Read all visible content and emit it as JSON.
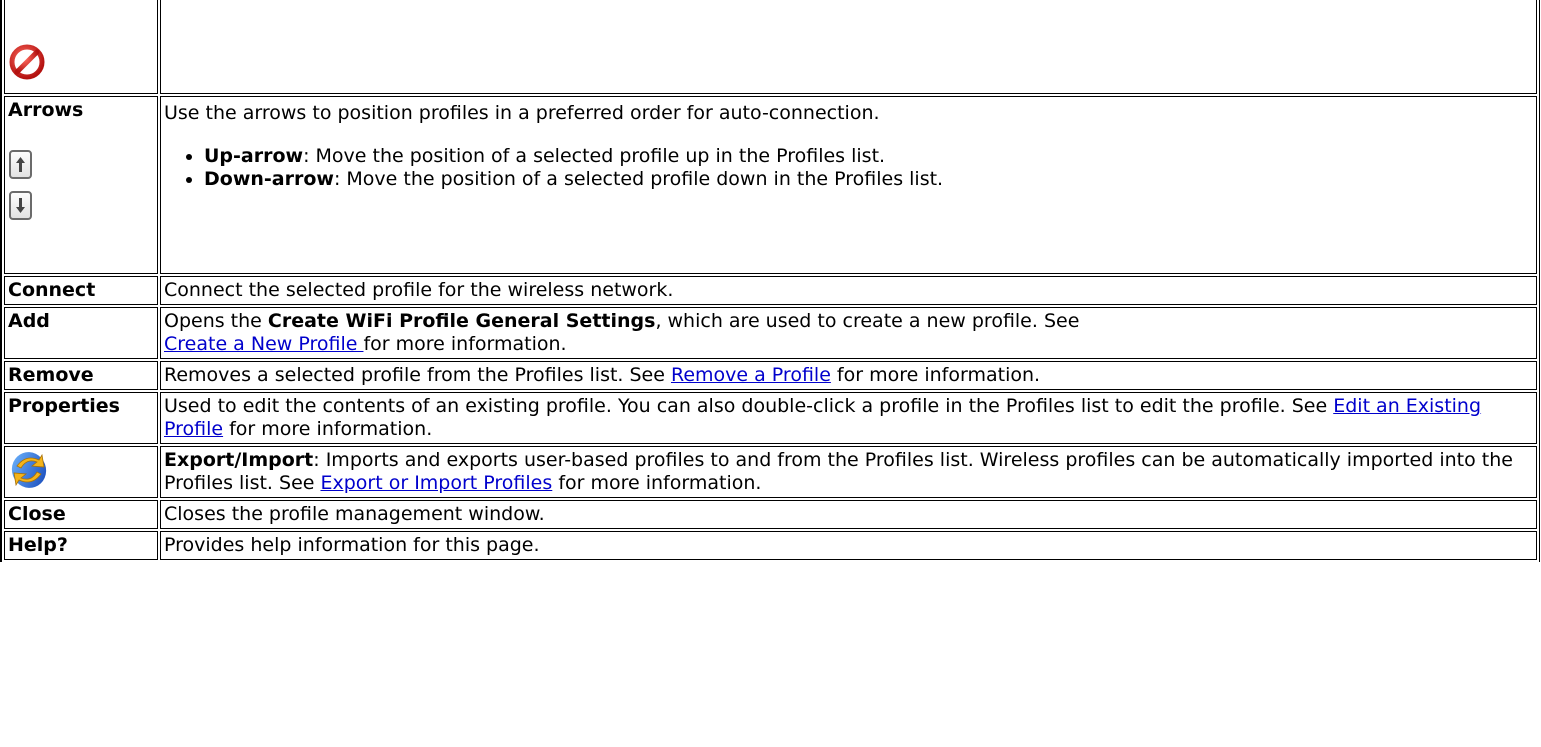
{
  "icons": {
    "no_entry": "no-entry-icon",
    "up_arrow": "up-arrow-icon",
    "down_arrow": "down-arrow-icon",
    "export_import": "export-import-icon"
  },
  "colors": {
    "link": "#0000cc",
    "no_entry_red": "#d8201f",
    "sync_blue": "#1f6fe0",
    "sync_gold": "#f3b21a"
  },
  "rows": {
    "arrows": {
      "term": "Arrows",
      "desc": "Use the arrows to position profiles in a preferred order for auto-connection.",
      "bullets": [
        {
          "label": "Up-arrow",
          "text": ": Move the position of a selected profile up in the Profiles list."
        },
        {
          "label": "Down-arrow",
          "text": ": Move the position of a selected profile down in the Profiles list."
        }
      ]
    },
    "connect": {
      "term": "Connect",
      "desc": "Connect the selected profile for the wireless network."
    },
    "add": {
      "term": "Add",
      "desc_prefix": "Opens the ",
      "desc_bold": "Create WiFi Profile General Settings",
      "desc_mid": ", which are used to create a new profile. See ",
      "link": "Create a New Profile ",
      "desc_suffix": "for more information."
    },
    "remove": {
      "term": "Remove",
      "desc_prefix": "Removes a selected profile from the Profiles list. See ",
      "link": "Remove a Profile",
      "desc_suffix": " for more information."
    },
    "properties": {
      "term": "Properties",
      "desc_prefix": "Used to edit the contents of an existing profile. You can also double-click a profile in the Profiles list to edit the profile. See ",
      "link": "Edit an Existing Profile",
      "desc_suffix": " for more information."
    },
    "export_import": {
      "desc_bold": "Export/Import",
      "desc_prefix": ": Imports and exports user-based profiles to and from the Profiles list. Wireless profiles can be automatically imported into the Profiles list. See ",
      "link": "Export or Import Profiles",
      "desc_suffix": " for more information."
    },
    "close": {
      "term": "Close",
      "desc": "Closes the profile management window."
    },
    "help": {
      "term": "Help?",
      "desc": "Provides help information for this page."
    }
  }
}
